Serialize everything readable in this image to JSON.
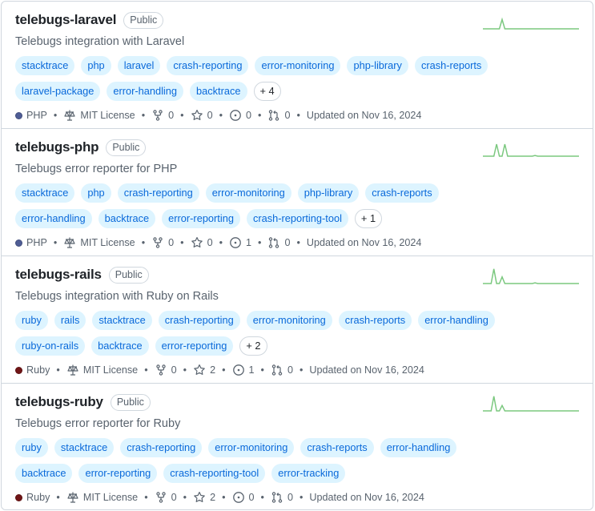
{
  "repos": [
    {
      "name": "telebugs-laravel",
      "visibility": "Public",
      "description": "Telebugs integration with Laravel",
      "topics": [
        "stacktrace",
        "php",
        "laravel",
        "crash-reporting",
        "error-monitoring",
        "php-library",
        "crash-reports",
        "laravel-package",
        "error-handling",
        "backtrace"
      ],
      "more": "+ 4",
      "language": "PHP",
      "language_color": "#4F5D95",
      "license": "MIT License",
      "forks": "0",
      "stars": "0",
      "issues": "0",
      "pulls": "0",
      "updated": "Updated on Nov 16, 2024",
      "spark": [
        0,
        0,
        0,
        0,
        0,
        0,
        0,
        14,
        0,
        0,
        0,
        0,
        0,
        0,
        0,
        0,
        0,
        0,
        0,
        0,
        0,
        0,
        0,
        0,
        0,
        0,
        0,
        0,
        0,
        0,
        0,
        0,
        0,
        0,
        0,
        0
      ]
    },
    {
      "name": "telebugs-php",
      "visibility": "Public",
      "description": "Telebugs error reporter for PHP",
      "topics": [
        "stacktrace",
        "php",
        "crash-reporting",
        "error-monitoring",
        "php-library",
        "crash-reports",
        "error-handling",
        "backtrace",
        "error-reporting",
        "crash-reporting-tool"
      ],
      "more": "+ 1",
      "language": "PHP",
      "language_color": "#4F5D95",
      "license": "MIT License",
      "forks": "0",
      "stars": "0",
      "issues": "1",
      "pulls": "0",
      "updated": "Updated on Nov 16, 2024",
      "spark": [
        0,
        0,
        0,
        0,
        0,
        18,
        0,
        0,
        18,
        0,
        0,
        0,
        0,
        0,
        0,
        0,
        0,
        0,
        0,
        1,
        0,
        0,
        0,
        0,
        0,
        0,
        0,
        0,
        0,
        0,
        0,
        0,
        0,
        0,
        0,
        0
      ]
    },
    {
      "name": "telebugs-rails",
      "visibility": "Public",
      "description": "Telebugs integration with Ruby on Rails",
      "topics": [
        "ruby",
        "rails",
        "stacktrace",
        "crash-reporting",
        "error-monitoring",
        "crash-reports",
        "error-handling",
        "ruby-on-rails",
        "backtrace",
        "error-reporting"
      ],
      "more": "+ 2",
      "language": "Ruby",
      "language_color": "#701516",
      "license": "MIT License",
      "forks": "0",
      "stars": "2",
      "issues": "1",
      "pulls": "0",
      "updated": "Updated on Nov 16, 2024",
      "spark": [
        0,
        0,
        0,
        0,
        22,
        0,
        0,
        10,
        0,
        0,
        0,
        0,
        0,
        0,
        0,
        0,
        0,
        0,
        0,
        1,
        0,
        0,
        0,
        0,
        0,
        0,
        0,
        0,
        0,
        0,
        0,
        0,
        0,
        0,
        0,
        0
      ]
    },
    {
      "name": "telebugs-ruby",
      "visibility": "Public",
      "description": "Telebugs error reporter for Ruby",
      "topics": [
        "ruby",
        "stacktrace",
        "crash-reporting",
        "error-monitoring",
        "crash-reports",
        "error-handling",
        "backtrace",
        "error-reporting",
        "crash-reporting-tool",
        "error-tracking"
      ],
      "more": "",
      "language": "Ruby",
      "language_color": "#701516",
      "license": "MIT License",
      "forks": "0",
      "stars": "2",
      "issues": "0",
      "pulls": "0",
      "updated": "Updated on Nov 16, 2024",
      "spark": [
        0,
        0,
        0,
        0,
        22,
        0,
        0,
        8,
        0,
        0,
        0,
        0,
        0,
        0,
        0,
        0,
        0,
        0,
        0,
        0,
        0,
        0,
        0,
        0,
        0,
        0,
        0,
        0,
        0,
        0,
        0,
        0,
        0,
        0,
        0,
        0
      ]
    }
  ]
}
